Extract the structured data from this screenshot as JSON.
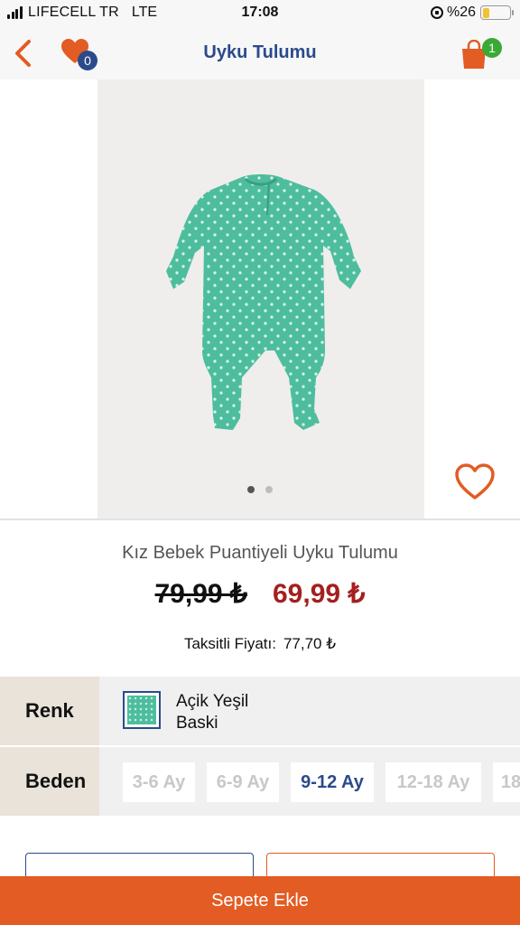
{
  "status_bar": {
    "carrier": "LIFECELL TR",
    "network": "LTE",
    "time": "17:08",
    "battery": "%26",
    "battery_level": 0.26
  },
  "nav": {
    "title": "Uyku Tulumu",
    "favorites_count": "0",
    "cart_count": "1",
    "accent_color": "#e25c24",
    "title_color": "#2b4a8c"
  },
  "gallery": {
    "image_count": 2,
    "active_index": 0
  },
  "product": {
    "name": "Kız Bebek Puantiyeli Uyku Tulumu",
    "old_price": "79,99 ₺",
    "new_price": "69,99 ₺",
    "installment_label": "Taksitli Fiyatı:",
    "installment_price": "77,70 ₺"
  },
  "options": {
    "color_label": "Renk",
    "color_name_line1": "Açik Yeşil",
    "color_name_line2": "Baski",
    "size_label": "Beden",
    "sizes": [
      "3-6 Ay",
      "6-9 Ay",
      "9-12 Ay",
      "12-18 Ay",
      "18"
    ],
    "selected_size": "9-12 Ay"
  },
  "actions": {
    "add_to_cart": "Sepete Ekle"
  }
}
